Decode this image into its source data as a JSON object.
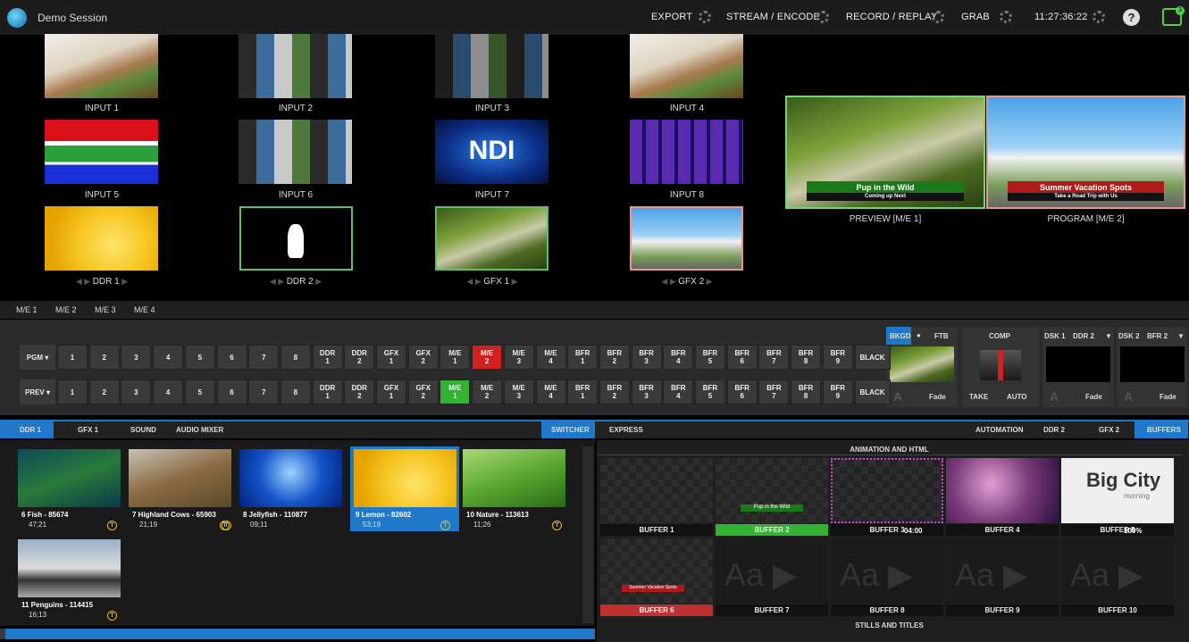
{
  "top": {
    "session": "Demo Session",
    "export": "EXPORT",
    "stream": "STREAM / ENCODE",
    "record": "RECORD / REPLAY",
    "grab": "GRAB",
    "clock": "11:27:36:22",
    "help": "?",
    "badge": "3"
  },
  "inputs": [
    "INPUT 1",
    "INPUT 2",
    "INPUT 3",
    "INPUT 4",
    "INPUT 5",
    "INPUT 6",
    "INPUT 7",
    "INPUT 8"
  ],
  "players": [
    "DDR 1",
    "DDR 2",
    "GFX 1",
    "GFX 2"
  ],
  "ndi_text": "NDI",
  "preview": {
    "label": "PREVIEW [M/E 1]",
    "title": "Pup in the Wild",
    "sub": "Coming up Next"
  },
  "program": {
    "label": "PROGRAM [M/E 2]",
    "title": "Summer Vacation Spots",
    "sub": "Take a Road Trip with Us"
  },
  "me_tabs": [
    "M/E 1",
    "M/E 2",
    "M/E 3",
    "M/E 4"
  ],
  "switcher": {
    "pgm_label": "PGM ▾",
    "prev_label": "PREV ▾",
    "buttons": [
      "1",
      "2",
      "3",
      "4",
      "5",
      "6",
      "7",
      "8",
      "DDR\n1",
      "DDR\n2",
      "GFX\n1",
      "GFX\n2",
      "M/E\n1",
      "M/E\n2",
      "M/E\n3",
      "M/E\n4",
      "BFR\n1",
      "BFR\n2",
      "BFR\n3",
      "BFR\n4",
      "BFR\n5",
      "BFR\n6",
      "BFR\n7",
      "BFR\n8",
      "BFR\n9",
      "BLACK"
    ],
    "pgm_active": "M/E\n2",
    "prev_active": "M/E\n1",
    "bkgd": "BKGD",
    "ftb": "FTB",
    "comp": "COMP",
    "take": "TAKE",
    "auto": "AUTO",
    "fade": "Fade",
    "dsk1": "DSK 1",
    "dsk1_sel": "DDR 2",
    "dsk2": "DSK 2",
    "dsk2_sel": "BFR 2"
  },
  "left_tabs": [
    "DDR 1",
    "GFX 1",
    "SOUND",
    "AUDIO MIXER",
    "SWITCHER"
  ],
  "right_tabs": [
    "EXPRESS",
    "AUTOMATION",
    "DDR 2",
    "GFX 2",
    "BUFFERS"
  ],
  "clips": [
    {
      "title": "6 Fish - 85674",
      "time": "47;21",
      "c": "T"
    },
    {
      "title": "7 Highland Cows - 65903",
      "time": "21;19",
      "c": "T"
    },
    {
      "title": "8 Jellyfish - 110877",
      "time": "09;11",
      "c": "T"
    },
    {
      "title": "9 Lemon - 82602",
      "time": "53;19",
      "c": "T"
    },
    {
      "title": "10 Nature - 113613",
      "time": "11;26",
      "c": "T"
    },
    {
      "title": "11 Penguins - 114415",
      "time": "16;13",
      "c": "T"
    }
  ],
  "anim_hdr": "ANIMATION AND HTML",
  "stills_hdr": "STILLS AND TITLES",
  "buffers": [
    "BUFFER 1",
    "BUFFER 2",
    "BUFFER 3",
    "BUFFER 4",
    "BUFFER 5",
    "BUFFER 6",
    "BUFFER 7",
    "BUFFER 8",
    "BUFFER 9",
    "BUFFER 10"
  ],
  "buf3_time": "04:00",
  "buf5_pct": "100%",
  "bigcity": "Big City",
  "morning": "morning",
  "buf2_text": "Pup in the Wild",
  "buf6_text": "Summer Vacation Spots"
}
